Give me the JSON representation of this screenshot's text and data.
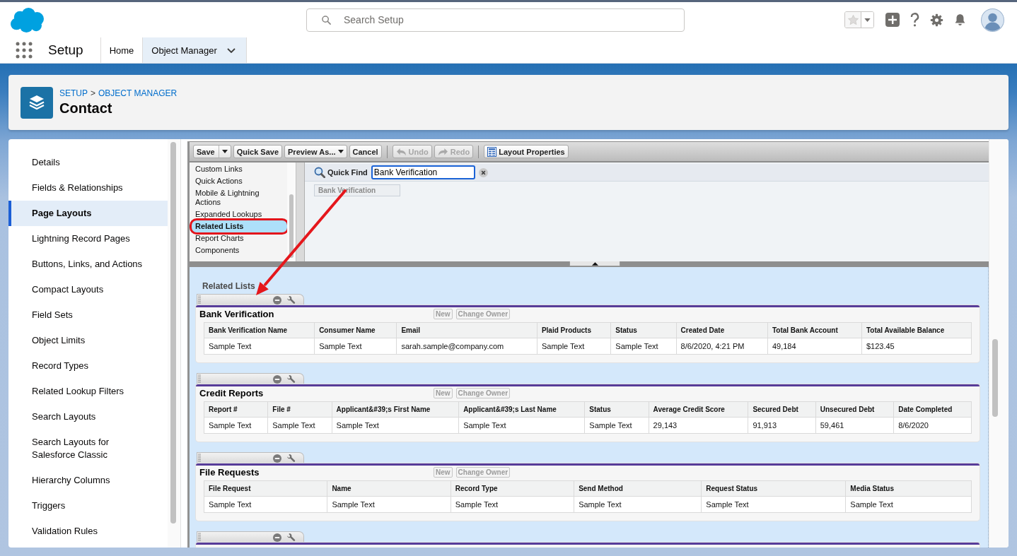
{
  "header": {
    "search_placeholder": "Search Setup"
  },
  "nav": {
    "app_name": "Setup",
    "tabs": [
      {
        "label": "Home",
        "selected": false,
        "has_menu": false
      },
      {
        "label": "Object Manager",
        "selected": true,
        "has_menu": true
      }
    ]
  },
  "page_header": {
    "breadcrumb": [
      {
        "label": "SETUP"
      },
      {
        "label": "OBJECT MANAGER"
      }
    ],
    "separator": ">",
    "title": "Contact"
  },
  "sidebar": {
    "items": [
      {
        "label": "Details",
        "selected": false
      },
      {
        "label": "Fields & Relationships",
        "selected": false
      },
      {
        "label": "Page Layouts",
        "selected": true
      },
      {
        "label": "Lightning Record Pages",
        "selected": false
      },
      {
        "label": "Buttons, Links, and Actions",
        "selected": false
      },
      {
        "label": "Compact Layouts",
        "selected": false
      },
      {
        "label": "Field Sets",
        "selected": false
      },
      {
        "label": "Object Limits",
        "selected": false
      },
      {
        "label": "Record Types",
        "selected": false
      },
      {
        "label": "Related Lookup Filters",
        "selected": false
      },
      {
        "label": "Search Layouts",
        "selected": false
      },
      {
        "label": "Search Layouts for Salesforce Classic",
        "selected": false
      },
      {
        "label": "Hierarchy Columns",
        "selected": false
      },
      {
        "label": "Triggers",
        "selected": false
      },
      {
        "label": "Validation Rules",
        "selected": false
      }
    ]
  },
  "editor": {
    "toolbar": {
      "groups": [
        {
          "buttons": [
            {
              "label": "Save",
              "kind": "split",
              "disabled": false
            },
            {
              "label": "Quick Save",
              "kind": "plain",
              "disabled": false
            },
            {
              "label": "Preview As...",
              "kind": "menu",
              "disabled": false
            },
            {
              "label": "Cancel",
              "kind": "plain",
              "disabled": false
            }
          ]
        },
        {
          "buttons": [
            {
              "label": "Undo",
              "kind": "undo",
              "disabled": true
            },
            {
              "label": "Redo",
              "kind": "redo",
              "disabled": true
            }
          ]
        },
        {
          "buttons": [
            {
              "label": "Layout Properties",
              "kind": "properties",
              "disabled": false
            }
          ]
        }
      ]
    },
    "palette": {
      "categories": [
        {
          "label": "Custom Links",
          "selected": false,
          "circled": false
        },
        {
          "label": "Quick Actions",
          "selected": false,
          "circled": false
        },
        {
          "label": "Mobile & Lightning Actions",
          "selected": false,
          "circled": false
        },
        {
          "label": "Expanded Lookups",
          "selected": false,
          "circled": false
        },
        {
          "label": "Related Lists",
          "selected": true,
          "circled": true
        },
        {
          "label": "Report Charts",
          "selected": false,
          "circled": false
        },
        {
          "label": "Components",
          "selected": false,
          "circled": false
        }
      ],
      "quick_find": {
        "label": "Quick Find",
        "value": "Bank Verification"
      },
      "items": [
        {
          "label": "Bank Verification",
          "disabled": true
        }
      ]
    },
    "layout": {
      "section_label": "Related Lists",
      "related_lists": [
        {
          "title": "Bank Verification",
          "buttons": [
            "New",
            "Change Owner"
          ],
          "columns": [
            "Bank Verification Name",
            "Consumer Name",
            "Email",
            "Plaid Products",
            "Status",
            "Created Date",
            "Total Bank Account",
            "Total Available Balance"
          ],
          "rows": [
            [
              "Sample Text",
              "Sample Text",
              "sarah.sample@company.com",
              "Sample Text",
              "Sample Text",
              "8/6/2020, 4:21 PM",
              "49,184",
              "$123.45"
            ]
          ]
        },
        {
          "title": "Credit Reports",
          "buttons": [
            "New",
            "Change Owner"
          ],
          "columns": [
            "Report #",
            "File #",
            "Applicant&#39;s First Name",
            "Applicant&#39;s Last Name",
            "Status",
            "Average Credit Score",
            "Secured Debt",
            "Unsecured Debt",
            "Date Completed"
          ],
          "rows": [
            [
              "Sample Text",
              "Sample Text",
              "Sample Text",
              "Sample Text",
              "Sample Text",
              "29,143",
              "91,913",
              "59,461",
              "8/6/2020"
            ]
          ]
        },
        {
          "title": "File Requests",
          "buttons": [
            "New",
            "Change Owner"
          ],
          "columns": [
            "File Request",
            "Name",
            "Record Type",
            "Send Method",
            "Request Status",
            "Media Status"
          ],
          "rows": [
            [
              "Sample Text",
              "Sample Text",
              "Sample Text",
              "Sample Text",
              "Sample Text",
              "Sample Text"
            ]
          ]
        }
      ]
    }
  }
}
